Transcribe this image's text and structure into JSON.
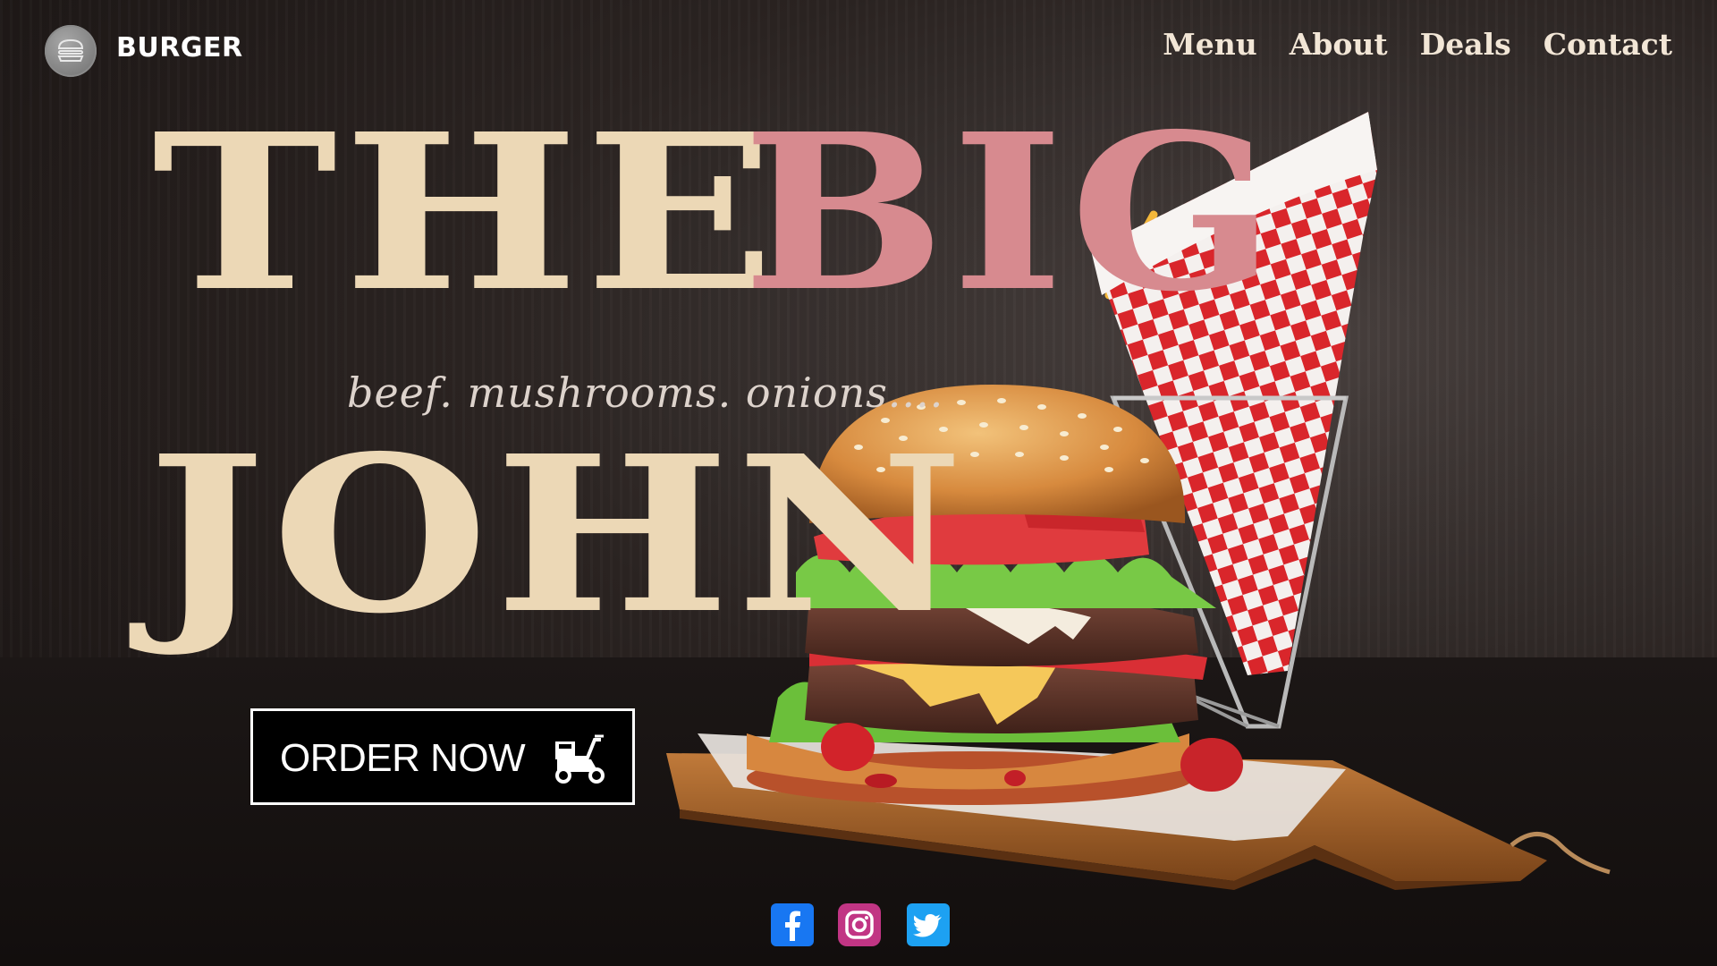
{
  "header": {
    "brand": "BURGER",
    "logo_icon": "burger-icon",
    "nav": [
      "Menu",
      "About",
      "Deals",
      "Contact"
    ]
  },
  "hero": {
    "line1_part1": "THE",
    "line1_part2": "BIG",
    "line2": "JOHN",
    "tagline": "beef. mushrooms. onions....",
    "order_button": "ORDER NOW",
    "order_icon": "delivery-scooter-icon"
  },
  "social": [
    {
      "name": "facebook-icon",
      "color": "#1877f2"
    },
    {
      "name": "instagram-icon",
      "color": "#c13584"
    },
    {
      "name": "twitter-icon",
      "color": "#1da1f2"
    }
  ],
  "colors": {
    "headline_cream": "#ecd8b6",
    "headline_pink": "#d78a8f",
    "background": "#231d1b"
  }
}
